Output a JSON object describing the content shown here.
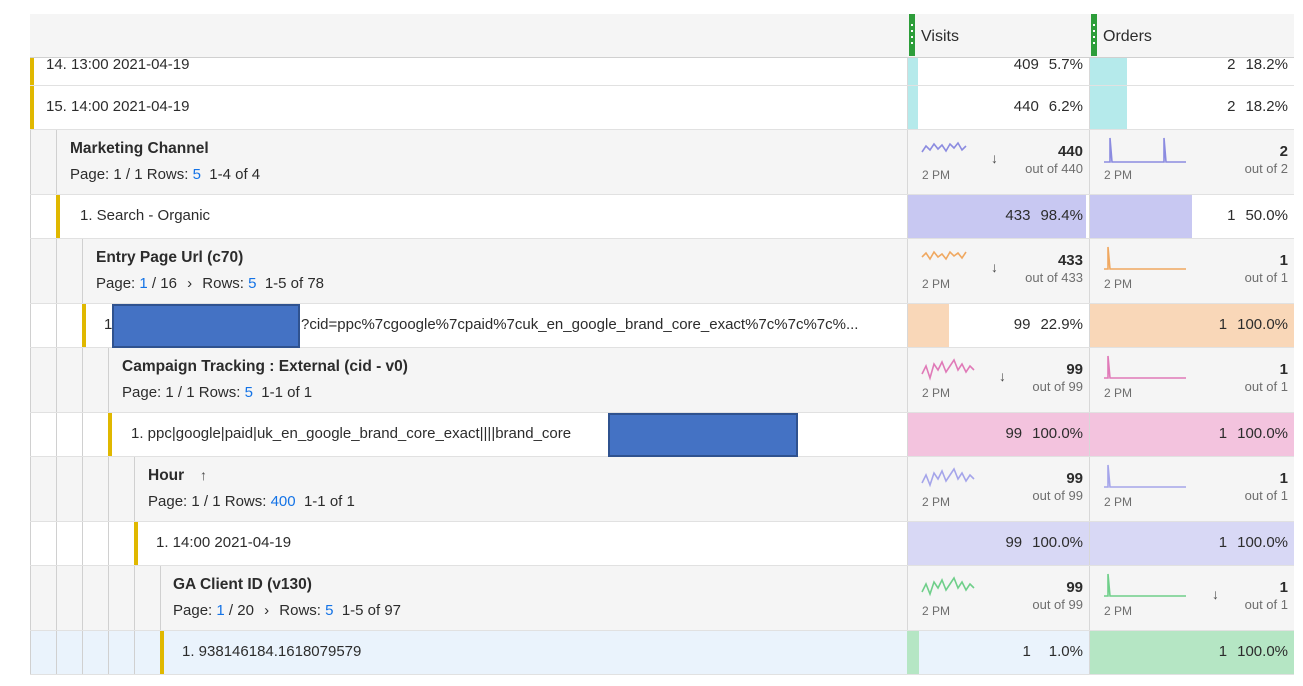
{
  "columns": {
    "visits": "Visits",
    "orders": "Orders"
  },
  "spark_time_label": "2 PM",
  "out_of_prefix": "out of",
  "colors": {
    "visits_row_fill": "#b5eaeb",
    "marketing_fill": "#c8c8f2",
    "entry_fill": "#f9d7b8",
    "campaign_fill": "#f3c3de",
    "hour_fill": "#d8d8f5",
    "client_fill": "#b5e6c4",
    "accent_bar": "#e0b800",
    "redaction": "#4472c4"
  },
  "top_rows": [
    {
      "label": "14. 13:00 2021-04-19",
      "visits": "409",
      "visits_pct": "5.7%",
      "orders": "2",
      "orders_pct": "18.2%",
      "visits_share": 0.057,
      "orders_share": 0.182
    },
    {
      "label": "15. 14:00 2021-04-19",
      "visits": "440",
      "visits_pct": "6.2%",
      "orders": "2",
      "orders_pct": "18.2%",
      "visits_share": 0.062,
      "orders_share": 0.182
    }
  ],
  "marketing": {
    "title": "Marketing Channel",
    "page_label": "Page: 1 / 1",
    "rows_label": "Rows:",
    "rows_value": "5",
    "range": "1-4 of 4",
    "visits_total": "440",
    "visits_out_of": "440",
    "orders_total": "2",
    "orders_out_of": "2"
  },
  "search_row": {
    "label": "1. Search - Organic",
    "visits": "433",
    "visits_pct": "98.4%",
    "orders": "1",
    "orders_pct": "50.0%",
    "visits_share": 0.984,
    "orders_share": 0.5
  },
  "entry": {
    "title": "Entry Page Url (c70)",
    "page_prefix": "Page:",
    "page_current": "1",
    "page_total": "/ 16",
    "rows_label": "Rows:",
    "rows_value": "5",
    "range": "1-5 of 78",
    "visits_total": "433",
    "visits_out_of": "433",
    "orders_total": "1",
    "orders_out_of": "1"
  },
  "entry_row": {
    "label_prefix": "1",
    "label": "?cid=ppc%7cgoogle%7cpaid%7cuk_en_google_brand_core_exact%7c%7c%7c%...",
    "visits": "99",
    "visits_pct": "22.9%",
    "orders": "1",
    "orders_pct": "100.0%",
    "visits_share": 0.229,
    "orders_share": 1.0
  },
  "campaign": {
    "title": "Campaign Tracking : External (cid - v0)",
    "page_label": "Page: 1 / 1",
    "rows_label": "Rows:",
    "rows_value": "5",
    "range": "1-1 of 1",
    "visits_total": "99",
    "visits_out_of": "99",
    "orders_total": "1",
    "orders_out_of": "1"
  },
  "campaign_row": {
    "label": "1. ppc|google|paid|uk_en_google_brand_core_exact||||brand_core",
    "visits": "99",
    "visits_pct": "100.0%",
    "orders": "1",
    "orders_pct": "100.0%",
    "visits_share": 1.0,
    "orders_share": 1.0
  },
  "hour": {
    "title": "Hour",
    "page_label": "Page: 1 / 1",
    "rows_label": "Rows:",
    "rows_value": "400",
    "range": "1-1 of 1",
    "visits_total": "99",
    "visits_out_of": "99",
    "orders_total": "1",
    "orders_out_of": "1"
  },
  "hour_row": {
    "label": "1. 14:00 2021-04-19",
    "visits": "99",
    "visits_pct": "100.0%",
    "orders": "1",
    "orders_pct": "100.0%",
    "visits_share": 1.0,
    "orders_share": 1.0
  },
  "client": {
    "title": "GA Client ID (v130)",
    "page_prefix": "Page:",
    "page_current": "1",
    "page_total": "/ 20",
    "rows_label": "Rows:",
    "rows_value": "5",
    "range": "1-5 of 97",
    "visits_total": "99",
    "visits_out_of": "99",
    "orders_total": "1",
    "orders_out_of": "1"
  },
  "client_row": {
    "label": "1. 938146184.1618079579",
    "visits": "1",
    "visits_pct": "1.0%",
    "orders": "1",
    "orders_pct": "100.0%",
    "visits_share": 0.01,
    "orders_share": 1.0
  }
}
